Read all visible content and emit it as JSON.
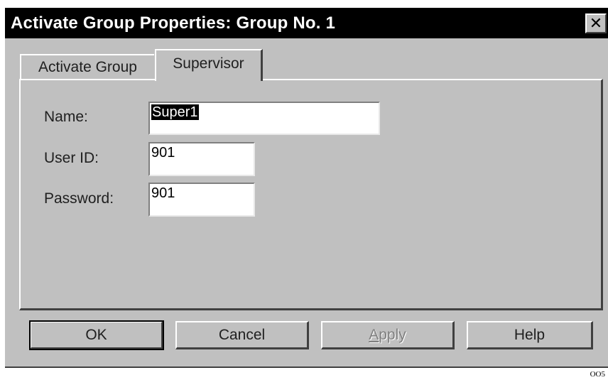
{
  "dialog": {
    "title": "Activate Group Properties: Group No. 1",
    "close_glyph": "✕"
  },
  "tabs": [
    {
      "label": "Activate Group",
      "active": false
    },
    {
      "label": "Supervisor",
      "active": true
    }
  ],
  "form": {
    "name_label": "Name:",
    "name_value": "Super1",
    "userid_label": "User ID:",
    "userid_value": "901",
    "password_label": "Password:",
    "password_value": "901"
  },
  "buttons": {
    "ok": "OK",
    "cancel": "Cancel",
    "apply_first": "A",
    "apply_rest": "pply",
    "help": "Help"
  },
  "figure_code": "OO5",
  "colors": {
    "dialog_face": "#c0c0c0",
    "titlebar": "#000000",
    "disabled_text": "#808080"
  }
}
